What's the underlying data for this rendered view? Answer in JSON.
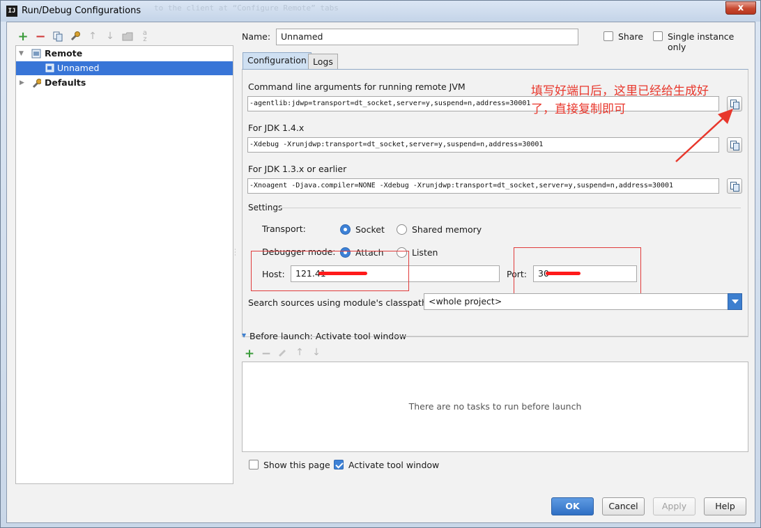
{
  "window": {
    "title": "Run/Debug Configurations",
    "title_icon": "IJ",
    "background_text": "to the client at “Configure Remote” tabs",
    "close_label": "x"
  },
  "tree": {
    "items": [
      {
        "label": "Remote",
        "icon": "remote-config-icon",
        "expanded": true
      },
      {
        "label": "Unnamed",
        "icon": "remote-instance-icon",
        "selected": true
      },
      {
        "label": "Defaults",
        "icon": "defaults-wrench-icon",
        "expanded": false
      }
    ]
  },
  "toolbar": {
    "add": "+",
    "remove": "−",
    "copy": "copy-icon",
    "edit_defaults": "wrench-icon",
    "move_up": "↑",
    "move_down": "↓",
    "folder": "folder-icon",
    "sort": "sort-icon"
  },
  "header": {
    "name_label": "Name:",
    "name_value": "Unnamed",
    "share_label": "Share",
    "share_checked": false,
    "single_instance_label": "Single instance only",
    "single_instance_checked": false
  },
  "tabs": [
    {
      "label": "Configuration",
      "active": true
    },
    {
      "label": "Logs",
      "active": false
    }
  ],
  "config": {
    "cmd_label": "Command line arguments for running remote JVM",
    "cmd_value": "-agentlib:jdwp=transport=dt_socket,server=y,suspend=n,address=30001",
    "jdk14_label": "For JDK 1.4.x",
    "jdk14_value": "-Xdebug -Xrunjdwp:transport=dt_socket,server=y,suspend=n,address=30001",
    "jdk13_label": "For JDK 1.3.x or earlier",
    "jdk13_value": "-Xnoagent -Djava.compiler=NONE -Xdebug -Xrunjdwp:transport=dt_socket,server=y,suspend=n,address=30001",
    "settings_label": "Settings",
    "transport_label": "Transport:",
    "transport_socket": "Socket",
    "transport_shared": "Shared memory",
    "transport_selected": "Socket",
    "debugger_mode_label": "Debugger mode:",
    "mode_attach": "Attach",
    "mode_listen": "Listen",
    "mode_selected": "Attach",
    "host_label": "Host:",
    "host_value": "121.41",
    "port_label": "Port:",
    "port_value": "30",
    "search_sources_label": "Search sources using module's classpath:",
    "search_sources_value": "<whole project>"
  },
  "annotation": {
    "line1": "填写好端口后，这里已经给生成好",
    "line2": "了，直接复制即可",
    "color": "#e8372c"
  },
  "before_launch": {
    "title": "Before launch: Activate tool window",
    "add": "+",
    "remove": "−",
    "edit": "pencil-icon",
    "up": "↑",
    "down": "↓",
    "empty_text": "There are no tasks to run before launch",
    "show_page_label": "Show this page",
    "show_page_checked": false,
    "activate_label": "Activate tool window",
    "activate_checked": true
  },
  "buttons": {
    "ok": "OK",
    "cancel": "Cancel",
    "apply": "Apply",
    "help": "Help"
  },
  "colors": {
    "selection": "#3875d7",
    "accent": "#3d81d6",
    "annotation_red": "#e8372c"
  }
}
